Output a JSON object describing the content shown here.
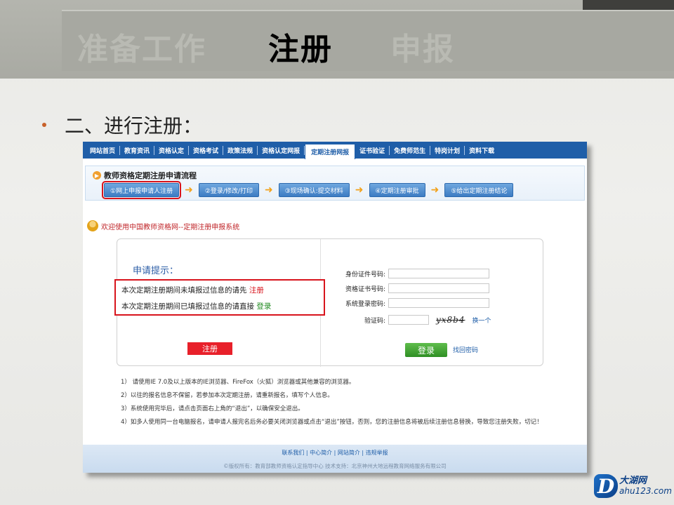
{
  "header": {
    "tabs": [
      {
        "label": "准备工作",
        "state": "dim"
      },
      {
        "label": "注册",
        "state": "active"
      },
      {
        "label": "申报",
        "state": "dim"
      }
    ]
  },
  "bullet": "二、进行注册：",
  "site": {
    "nav": [
      "网站首页",
      "教育资讯",
      "资格认定",
      "资格考试",
      "政策法规",
      "资格认定网报",
      "定期注册网报",
      "证书验证",
      "免费师范生",
      "特岗计划",
      "资料下载"
    ],
    "nav_active_index": 6,
    "flow_title": "教师资格定期注册申请流程",
    "steps": [
      "①网上申报申请人注册",
      "②登录/修改/打印",
      "③现场确认:提交材料",
      "④定期注册审批",
      "⑤给出定期注册结论"
    ],
    "welcome": "欢迎使用中国教师资格网--定期注册申报系统",
    "tip": {
      "title": "申请提示：",
      "line1_prefix": "本次定期注册期间未填报过信息的请先",
      "line1_action": "注册",
      "line2_prefix": "本次定期注册期间已填报过信息的请直接",
      "line2_action": "登录"
    },
    "register_button": "注册",
    "form": {
      "id_label": "身份证件号码:",
      "cert_label": "资格证书号码:",
      "password_label": "系统登录密码:",
      "captcha_label": "验证码:",
      "captcha_text": "yx8b4",
      "swap_label": "换一个",
      "login_button": "登录",
      "forgot_label": "找回密码"
    },
    "notes": [
      "1） 请使用IE 7.0及以上版本的IE浏览器、FireFox（火狐）浏览器或其他兼容的浏览器。",
      "2）以往的报名信息不保留，若参加本次定期注册，请重新报名，填写个人信息。",
      "3）系统使用完毕后，请点击页面右上角的“退出”，以确保安全退出。",
      "4）如多人使用同一台电脑报名，请申请人报完名后务必要关闭浏览器或点击“退出”按钮，否则，您的注册信息将被后续注册信息替换，导致您注册失败，切记！"
    ],
    "footer_links": "联系我们 | 中心简介 | 网站简介 | 违规举报",
    "footer_copy": "©版权所有：教育部教师资格认定指导中心  技术支持：北京神州大地远程教育网络服务有限公司"
  },
  "brand": {
    "cn": "大湖网",
    "en": "ahu123.com",
    "letter": "D"
  },
  "colors": {
    "nav_blue": "#1f5ea8",
    "highlight_red": "#d8141c",
    "login_green": "#2f8f24",
    "arrow_orange": "#f2a11a"
  }
}
